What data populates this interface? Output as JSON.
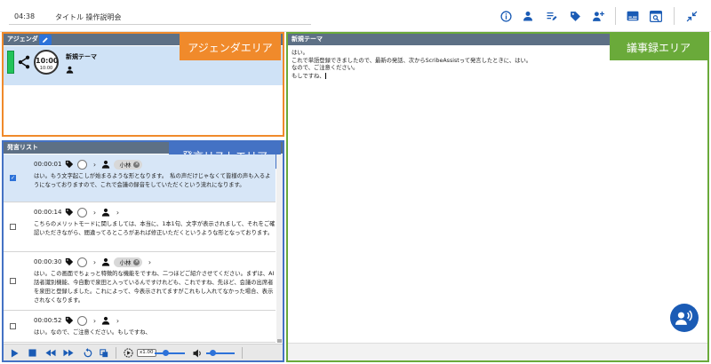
{
  "topbar": {
    "time": "04:38",
    "title": "タイトル 操作説明会",
    "icons": [
      "info-icon",
      "person-icon",
      "playlist-edit-icon",
      "tag-icon",
      "person-add-mic-icon",
      "subtitles-icon",
      "find-in-page-icon",
      "collapse-icon"
    ]
  },
  "agenda": {
    "header": "アジェンダ",
    "area_label": "アジェンダエリア",
    "item": {
      "timer_main": "10:00",
      "timer_sub": "10:00",
      "title": "新規テーマ"
    }
  },
  "utterance_list": {
    "header": "発言リスト",
    "area_label": "発言リストエリア",
    "items": [
      {
        "time": "00:00:01",
        "speaker": "小林",
        "checked": true,
        "text": "はい。もう文字起こしが始まるような形となります。　私の声だけじゃなくて皆様の声も入るようになっておりますので、これで会議の録音をしていただくという流れになります。"
      },
      {
        "time": "00:00:14",
        "speaker": "",
        "checked": false,
        "text": "こちらのメリットモードに関しましては、本当に、1本1句、文字が表示されまして、それをご確認いただきながら、間違ってるところがあれば修正いただくというような形となっております。"
      },
      {
        "time": "00:00:30",
        "speaker": "小林",
        "checked": false,
        "text": "はい。この画面でちょっと特徴的な機能をですね、二つほどご紹介させてください。まずは、AI話者識別機能、今自動で泉田と入っているんですけれども、これですね、先ほど、会議の出席者を泉田と登録しました。これによって、今表示されてますがこれもし入れてなかった場合、表示されなくなります。"
      },
      {
        "time": "00:00:52",
        "speaker": "",
        "checked": false,
        "text": "はい。なので、ご注意ください。もしですね、"
      }
    ],
    "speed": "x1.00"
  },
  "minutes": {
    "header": "新規テーマ",
    "area_label": "議事録エリア",
    "lines": [
      "はい。",
      "これで単語登録できましたので、最新の発話、次からScribeAssistって発言したときに、はい。",
      "なので、ご注意ください。",
      "もしですね、"
    ]
  },
  "colors": {
    "agenda_accent": "#f08a2b",
    "utterance_accent": "#4472c4",
    "minutes_accent": "#6aaa3a",
    "header_bg": "#5d7085",
    "primary_blue": "#1a5bb5",
    "selected_row": "#d7e6f7",
    "agenda_row": "#cfe2f6",
    "timer_green": "#21c45a"
  }
}
